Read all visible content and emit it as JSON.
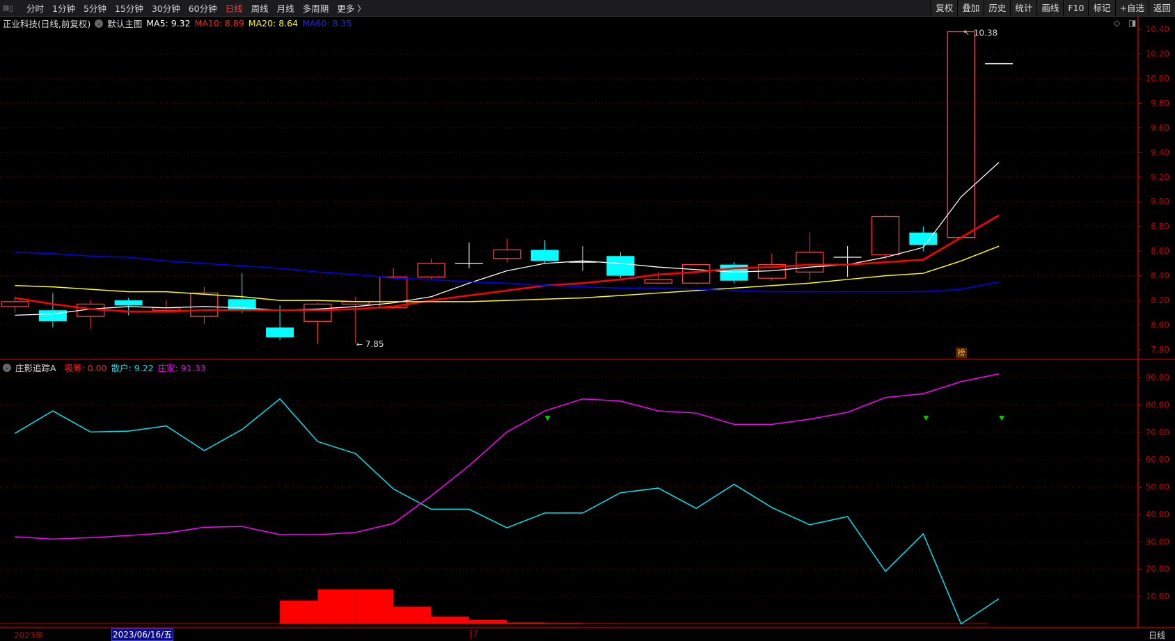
{
  "toolbar": {
    "periods": [
      "分时",
      "1分钟",
      "5分钟",
      "15分钟",
      "30分钟",
      "60分钟",
      "日线",
      "周线",
      "月线",
      "多周期",
      "更多 〉"
    ],
    "active_period": "日线",
    "right_buttons": [
      "复权",
      "叠加",
      "历史",
      "统计",
      "画线",
      "F10",
      "标记",
      "+自选",
      "返回"
    ]
  },
  "main_legend": {
    "title": "正业科技(日线,前复权)",
    "template": "默认主图",
    "ma5": "MA5: 9.32",
    "ma10": "MA10: 8.89",
    "ma20": "MA20: 8.64",
    "ma60": "MA60: 8.35"
  },
  "indicator_legend": {
    "name": "庄影追踪A",
    "xichou": "吸筹: 0.00",
    "sanhu": "散户: 9.22",
    "zhuangjia": "庄家: 91.33"
  },
  "annotations": {
    "high": "10.38",
    "low": "7.85",
    "badge": "榜"
  },
  "date_bar": {
    "year": "2023年",
    "selected_date": "2023/06/16/五",
    "month": "7",
    "period": "日线"
  },
  "colors": {
    "up": "#ff4040",
    "down": "#00ffff",
    "ma5": "#ffffff",
    "ma10": "#ff0000",
    "ma20": "#ffff00",
    "ma60": "#0000ff",
    "sanhu": "#00e5ee",
    "zhuangjia": "#ff00ff",
    "xichou": "#ff0000",
    "axis": "#c00000",
    "signal": "#00cc00"
  },
  "chart_data": [
    {
      "type": "candlestick",
      "title": "正业科技(日线,前复权)",
      "y_ticks": [
        "10.40",
        "10.20",
        "10.00",
        "9.80",
        "9.60",
        "9.40",
        "9.20",
        "9.00",
        "8.80",
        "8.60",
        "8.40",
        "8.20",
        "8.00",
        "7.80"
      ],
      "ylim": [
        7.8,
        10.4
      ],
      "ohlc": [
        [
          8.15,
          8.23,
          8.1,
          8.19
        ],
        [
          8.12,
          8.26,
          7.98,
          8.03
        ],
        [
          8.07,
          8.2,
          7.97,
          8.17
        ],
        [
          8.2,
          8.22,
          8.08,
          8.16
        ],
        [
          8.12,
          8.2,
          8.12,
          8.14
        ],
        [
          8.07,
          8.31,
          8.01,
          8.26
        ],
        [
          8.21,
          8.42,
          8.1,
          8.12
        ],
        [
          7.98,
          8.16,
          7.88,
          7.9
        ],
        [
          8.03,
          8.18,
          7.85,
          8.17
        ],
        [
          8.17,
          8.23,
          7.85,
          8.19
        ],
        [
          8.14,
          8.46,
          8.13,
          8.39
        ],
        [
          8.39,
          8.54,
          8.37,
          8.5
        ],
        [
          8.5,
          8.67,
          8.46,
          8.5
        ],
        [
          8.54,
          8.7,
          8.51,
          8.61
        ],
        [
          8.61,
          8.69,
          8.5,
          8.52
        ],
        [
          8.51,
          8.64,
          8.44,
          8.51
        ],
        [
          8.56,
          8.59,
          8.38,
          8.4
        ],
        [
          8.34,
          8.43,
          8.33,
          8.37
        ],
        [
          8.34,
          8.49,
          8.33,
          8.49
        ],
        [
          8.49,
          8.51,
          8.34,
          8.36
        ],
        [
          8.38,
          8.58,
          8.36,
          8.49
        ],
        [
          8.43,
          8.75,
          8.36,
          8.59
        ],
        [
          8.55,
          8.64,
          8.39,
          8.55
        ],
        [
          8.57,
          8.89,
          8.53,
          8.88
        ],
        [
          8.75,
          8.8,
          8.6,
          8.65
        ],
        [
          8.71,
          10.38,
          8.71,
          10.38
        ],
        [
          10.12,
          10.12,
          10.12,
          10.12
        ]
      ],
      "series": [
        {
          "name": "MA5",
          "values": [
            8.08,
            8.09,
            8.13,
            8.15,
            8.14,
            8.15,
            8.14,
            8.12,
            8.13,
            8.15,
            8.18,
            8.23,
            8.34,
            8.44,
            8.5,
            8.52,
            8.5,
            8.47,
            8.45,
            8.43,
            8.44,
            8.47,
            8.49,
            8.55,
            8.63,
            9.04,
            9.32
          ]
        },
        {
          "name": "MA10",
          "values": [
            8.22,
            8.17,
            8.13,
            8.11,
            8.11,
            8.12,
            8.12,
            8.12,
            8.12,
            8.13,
            8.15,
            8.2,
            8.24,
            8.28,
            8.32,
            8.34,
            8.37,
            8.41,
            8.43,
            8.46,
            8.47,
            8.49,
            8.49,
            8.51,
            8.53,
            8.71,
            8.89
          ]
        },
        {
          "name": "MA20",
          "values": [
            8.32,
            8.31,
            8.29,
            8.27,
            8.27,
            8.25,
            8.23,
            8.2,
            8.2,
            8.19,
            8.19,
            8.19,
            8.19,
            8.2,
            8.21,
            8.22,
            8.24,
            8.26,
            8.28,
            8.3,
            8.32,
            8.34,
            8.37,
            8.4,
            8.42,
            8.52,
            8.64
          ]
        },
        {
          "name": "MA60",
          "values": [
            8.59,
            8.58,
            8.56,
            8.55,
            8.52,
            8.5,
            8.48,
            8.46,
            8.43,
            8.41,
            8.38,
            8.37,
            8.35,
            8.34,
            8.32,
            8.31,
            8.3,
            8.3,
            8.29,
            8.28,
            8.27,
            8.27,
            8.27,
            8.27,
            8.27,
            8.29,
            8.35
          ]
        }
      ]
    },
    {
      "type": "line",
      "title": "庄影追踪A",
      "y_ticks": [
        "90.00",
        "80.00",
        "70.00",
        "60.00",
        "50.00",
        "40.00",
        "30.00",
        "20.00",
        "10.00"
      ],
      "ylim": [
        0,
        95
      ],
      "series": [
        {
          "name": "散户",
          "values": [
            69.6,
            77.8,
            70.1,
            70.4,
            72.3,
            63.3,
            71.0,
            82.2,
            66.6,
            62.2,
            49.3,
            41.9,
            41.9,
            35.1,
            40.5,
            40.5,
            47.9,
            49.6,
            42.2,
            51.0,
            42.5,
            36.2,
            39.2,
            19.2,
            32.9,
            0.0,
            9.22
          ]
        },
        {
          "name": "庄家",
          "values": [
            31.8,
            31.0,
            31.5,
            32.3,
            33.2,
            35.3,
            35.6,
            32.6,
            32.6,
            33.4,
            36.7,
            46.8,
            57.8,
            70.1,
            77.8,
            82.2,
            81.4,
            77.8,
            77.0,
            72.9,
            72.9,
            74.8,
            77.3,
            82.7,
            84.1,
            88.5,
            91.33
          ]
        },
        {
          "name": "吸筹",
          "type": "bar",
          "values": [
            0,
            0,
            0,
            0,
            0,
            0,
            0,
            8.5,
            12.6,
            12.6,
            6.3,
            2.7,
            1.4,
            0.5,
            0.3,
            0.2,
            0.1,
            0,
            0,
            0,
            0,
            0,
            0,
            0,
            0,
            0,
            0
          ]
        }
      ],
      "signals": {
        "indices": [
          14,
          24,
          26
        ],
        "level": 75
      }
    }
  ]
}
